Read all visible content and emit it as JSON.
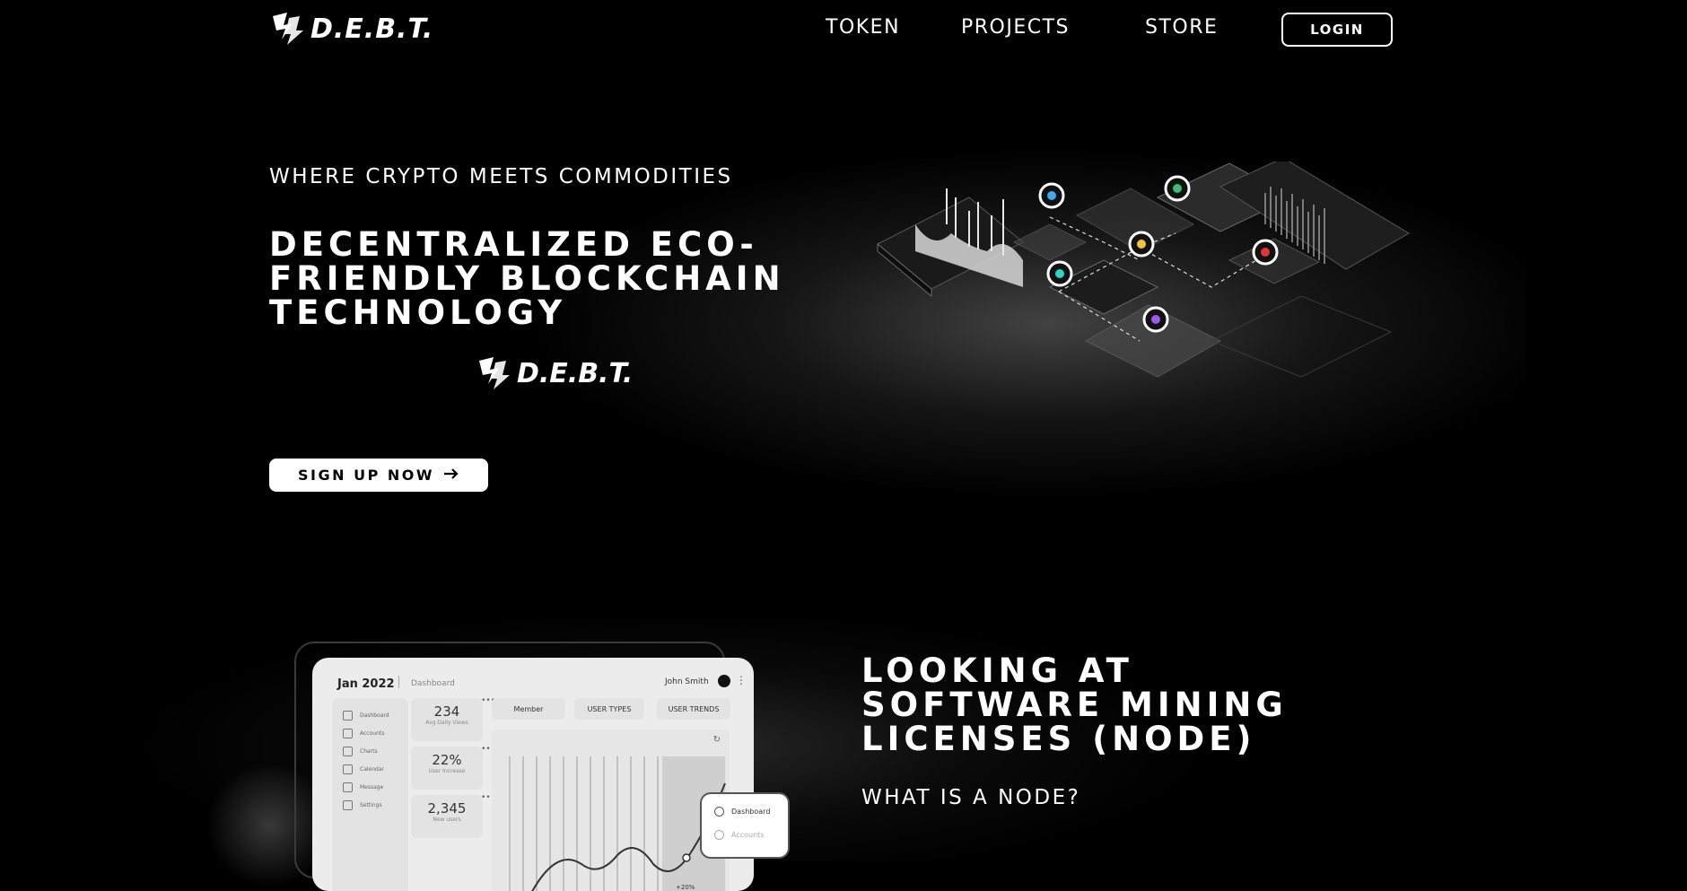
{
  "header": {
    "logo_text": "D.E.B.T.",
    "nav": [
      {
        "label": "TOKEN"
      },
      {
        "label": "PROJECTS"
      },
      {
        "label": "STORE"
      }
    ],
    "login_label": "LOGIN"
  },
  "hero": {
    "eyebrow": "WHERE CRYPTO MEETS COMMODITIES",
    "title_lines": [
      "DECENTRALIZED ECO-",
      "FRIENDLY BLOCKCHAIN",
      "TECHNOLOGY"
    ],
    "logo_text": "D.E.B.T.",
    "cta_label": "SIGN UP NOW",
    "cta_icon": "arrow-right-icon",
    "pin_colors": [
      "#3fa9f5",
      "#38c172",
      "#f6c23e",
      "#e3342f",
      "#2dd4bf",
      "#9f56f0"
    ]
  },
  "dashboard_mock": {
    "date": "Jan 2022",
    "breadcrumb": "Dashboard",
    "user": "John Smith",
    "sidebar": [
      "Dashboard",
      "Accounts",
      "Charts",
      "Calendar",
      "Message",
      "Settings"
    ],
    "stats": [
      {
        "value": "234",
        "label": "Avg Daily Views"
      },
      {
        "value": "22%",
        "label": "User Increase"
      },
      {
        "value": "2,345",
        "label": "New users"
      }
    ],
    "tabs": [
      "Member",
      "USER TYPES",
      "USER TRENDS"
    ],
    "chart_annotation": "+20%",
    "popup_items": [
      "Dashboard",
      "Accounts"
    ]
  },
  "section2": {
    "title_lines": [
      "LOOKING AT",
      "SOFTWARE MINING",
      "LICENSES (NODE)"
    ],
    "subtitle": "WHAT IS A NODE?"
  }
}
